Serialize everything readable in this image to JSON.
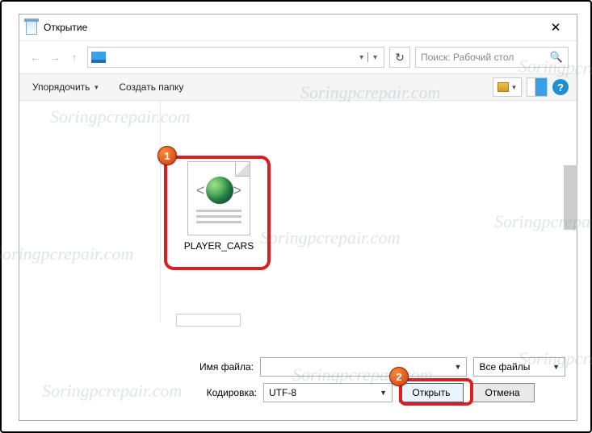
{
  "titlebar": {
    "title": "Открытие",
    "close": "✕"
  },
  "nav": {
    "back": "←",
    "forward": "→",
    "up": "↑",
    "refresh": "↻",
    "search_placeholder": "Поиск: Рабочий стол",
    "search_icon": "🔍"
  },
  "toolbar": {
    "organize": "Упорядочить",
    "new_folder": "Создать папку",
    "help": "?"
  },
  "file": {
    "name": "PLAYER_CARS"
  },
  "bottom": {
    "filename_label": "Имя файла:",
    "filename_value": "",
    "filetype_label": "Все файлы",
    "encoding_label": "Кодировка:",
    "encoding_value": "UTF-8",
    "open": "Открыть",
    "cancel": "Отмена"
  },
  "badges": {
    "one": "1",
    "two": "2"
  },
  "watermark": "Soringpcrepair.com"
}
